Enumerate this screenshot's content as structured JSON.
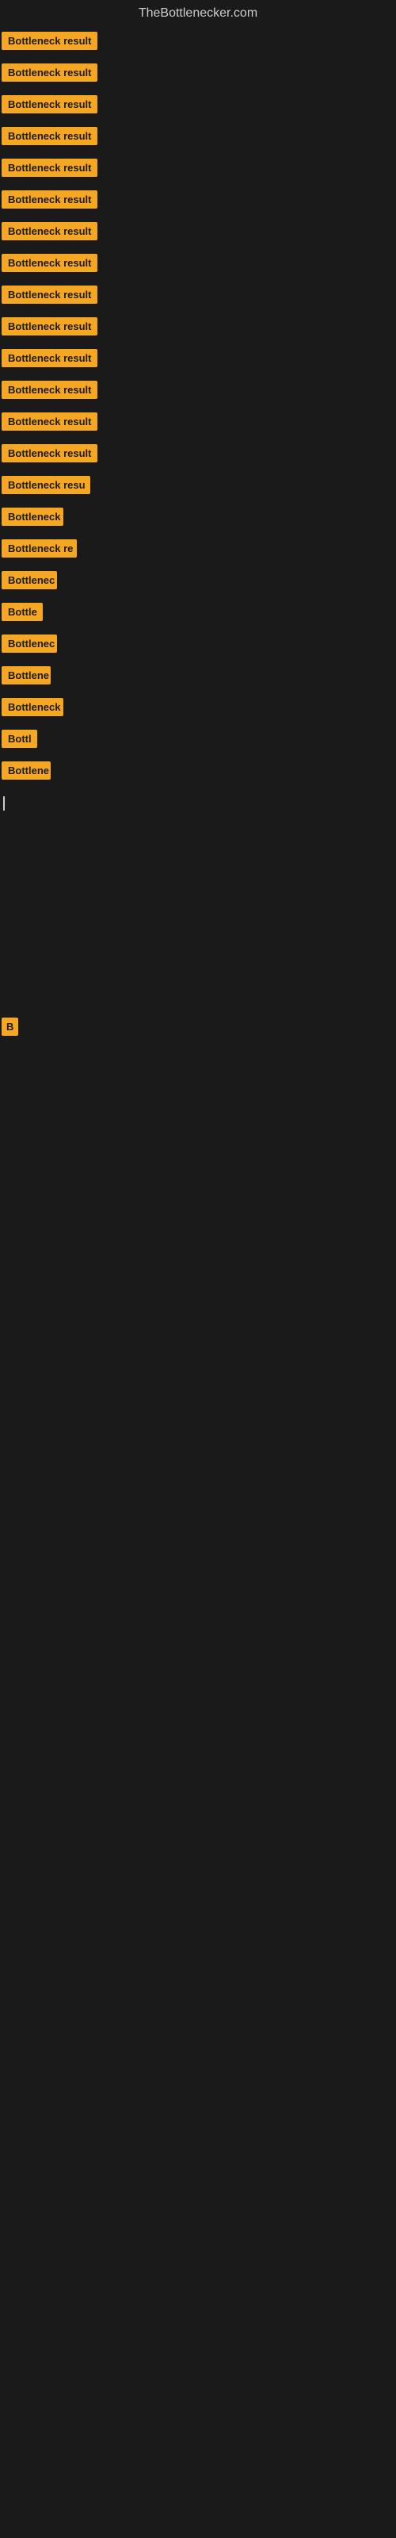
{
  "site": {
    "title": "TheBottlenecker.com"
  },
  "items": [
    {
      "id": 1,
      "label": "Bottleneck result",
      "width": 130
    },
    {
      "id": 2,
      "label": "Bottleneck result",
      "width": 130
    },
    {
      "id": 3,
      "label": "Bottleneck result",
      "width": 130
    },
    {
      "id": 4,
      "label": "Bottleneck result",
      "width": 130
    },
    {
      "id": 5,
      "label": "Bottleneck result",
      "width": 130
    },
    {
      "id": 6,
      "label": "Bottleneck result",
      "width": 130
    },
    {
      "id": 7,
      "label": "Bottleneck result",
      "width": 130
    },
    {
      "id": 8,
      "label": "Bottleneck result",
      "width": 130
    },
    {
      "id": 9,
      "label": "Bottleneck result",
      "width": 130
    },
    {
      "id": 10,
      "label": "Bottleneck result",
      "width": 130
    },
    {
      "id": 11,
      "label": "Bottleneck result",
      "width": 130
    },
    {
      "id": 12,
      "label": "Bottleneck result",
      "width": 130
    },
    {
      "id": 13,
      "label": "Bottleneck result",
      "width": 130
    },
    {
      "id": 14,
      "label": "Bottleneck result",
      "width": 130
    },
    {
      "id": 15,
      "label": "Bottleneck resu",
      "width": 112
    },
    {
      "id": 16,
      "label": "Bottleneck",
      "width": 78
    },
    {
      "id": 17,
      "label": "Bottleneck re",
      "width": 95
    },
    {
      "id": 18,
      "label": "Bottlenec",
      "width": 70
    },
    {
      "id": 19,
      "label": "Bottle",
      "width": 52
    },
    {
      "id": 20,
      "label": "Bottlenec",
      "width": 70
    },
    {
      "id": 21,
      "label": "Bottlene",
      "width": 62
    },
    {
      "id": 22,
      "label": "Bottleneck",
      "width": 78
    },
    {
      "id": 23,
      "label": "Bottl",
      "width": 45
    },
    {
      "id": 24,
      "label": "Bottlene",
      "width": 62
    }
  ],
  "cursor": {
    "label": "|"
  },
  "single_b": {
    "label": "B"
  }
}
